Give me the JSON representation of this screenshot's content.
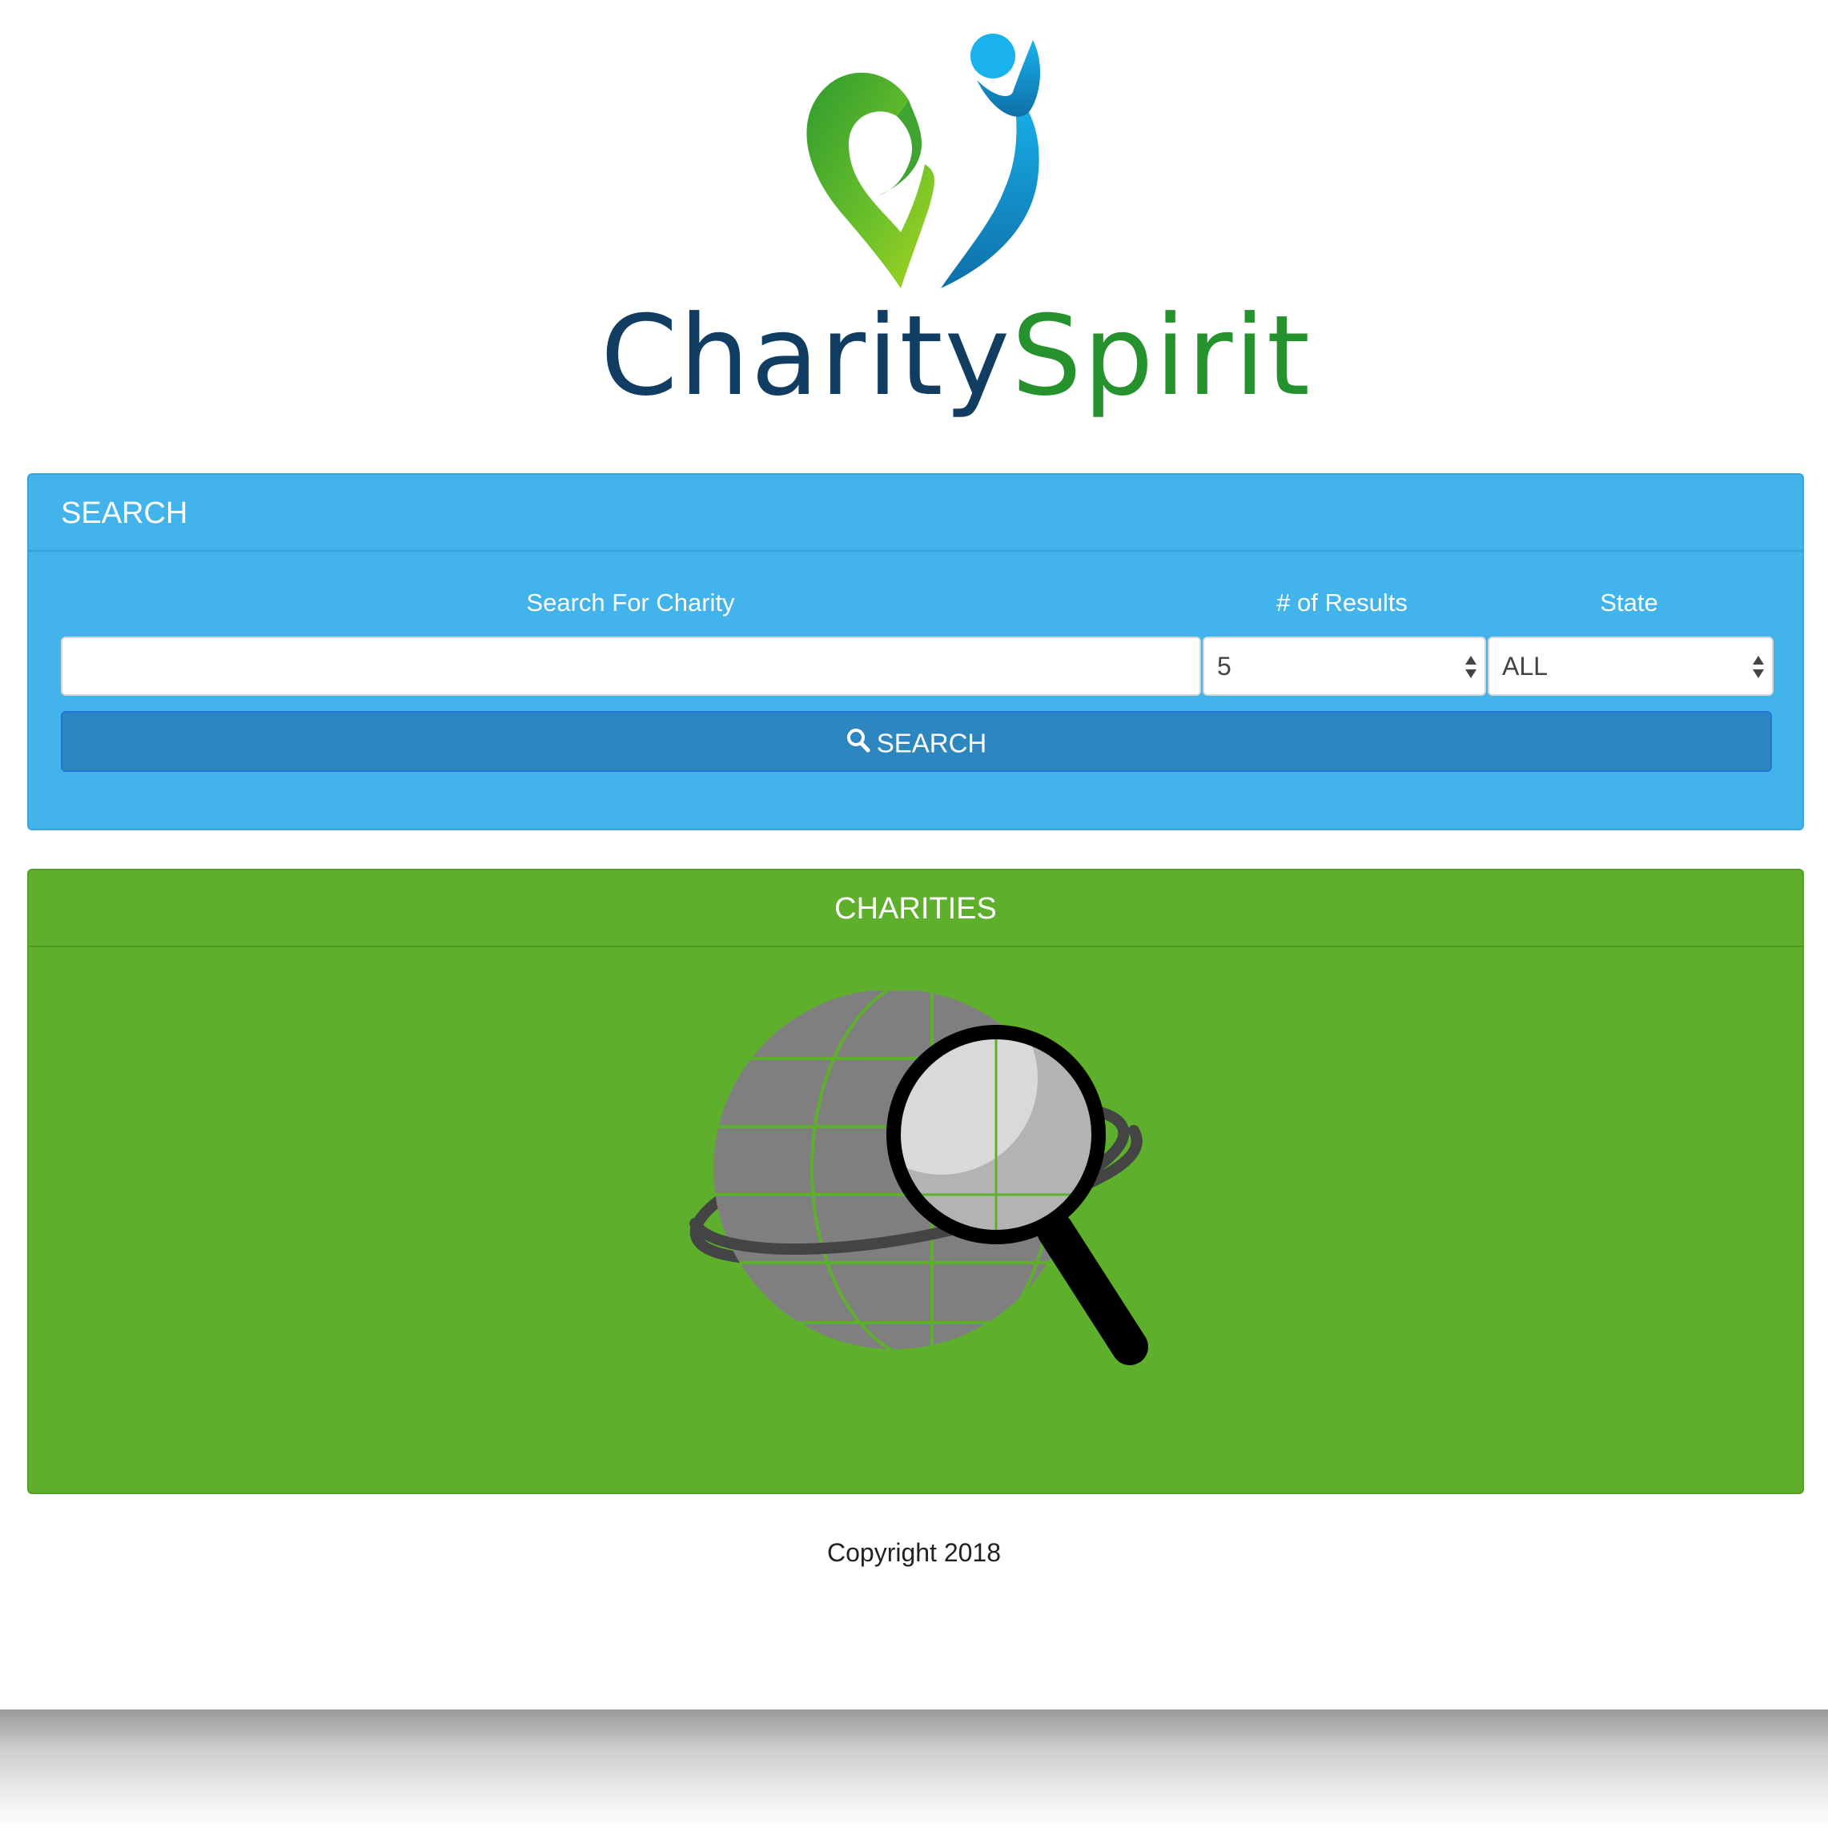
{
  "logo": {
    "word1": "Charity",
    "word2": "Spirit",
    "icon": "heart-with-person-icon",
    "colors": {
      "heart_green": "#6cc12a",
      "figure_blue": "#1aa0dc",
      "word1": "#123d63",
      "word2": "#25922e"
    }
  },
  "search_panel": {
    "title": "SEARCH",
    "labels": {
      "query": "Search For Charity",
      "results": "# of Results",
      "state": "State"
    },
    "query_value": "",
    "results_value": "5",
    "state_value": "ALL",
    "button_label": "SEARCH",
    "button_icon": "search-icon",
    "color": "#43b3ec",
    "button_color": "#2e86c1"
  },
  "charities_panel": {
    "title": "CHARITIES",
    "illustration": "globe-magnifier-icon",
    "color": "#5eb02c"
  },
  "footer": {
    "copyright": "Copyright 2018"
  }
}
